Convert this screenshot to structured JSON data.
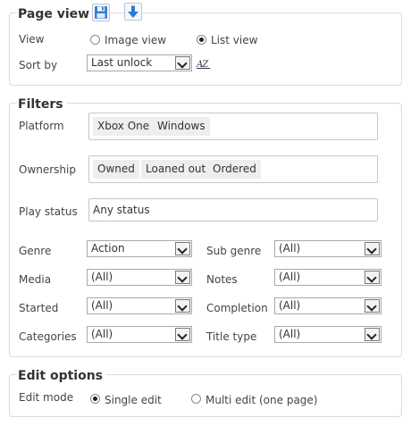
{
  "page_view": {
    "title": "Page view",
    "view_label": "View",
    "view_options": [
      "Image view",
      "List view"
    ],
    "view_selected": "List view",
    "sort_label": "Sort by",
    "sort_value": "Last unlock",
    "sort_direction_glyph": "AZ"
  },
  "filters": {
    "title": "Filters",
    "platform_label": "Platform",
    "platform_tags": [
      "Xbox One",
      "Windows"
    ],
    "ownership_label": "Ownership",
    "ownership_tags": [
      "Owned",
      "Loaned out",
      "Ordered"
    ],
    "play_status_label": "Play status",
    "play_status_value": "Any status",
    "genre_label": "Genre",
    "genre_value": "Action",
    "sub_genre_label": "Sub genre",
    "sub_genre_value": "(All)",
    "media_label": "Media",
    "media_value": "(All)",
    "notes_label": "Notes",
    "notes_value": "(All)",
    "started_label": "Started",
    "started_value": "(All)",
    "completion_label": "Completion",
    "completion_value": "(All)",
    "categories_label": "Categories",
    "categories_value": "(All)",
    "title_type_label": "Title type",
    "title_type_value": "(All)"
  },
  "edit_options": {
    "title": "Edit options",
    "edit_mode_label": "Edit mode",
    "modes": [
      "Single edit",
      "Multi edit (one page)"
    ],
    "mode_selected": "Single edit"
  },
  "colors": {
    "accent_blue": "#2a7bd4",
    "border": "#dcdcdc"
  }
}
